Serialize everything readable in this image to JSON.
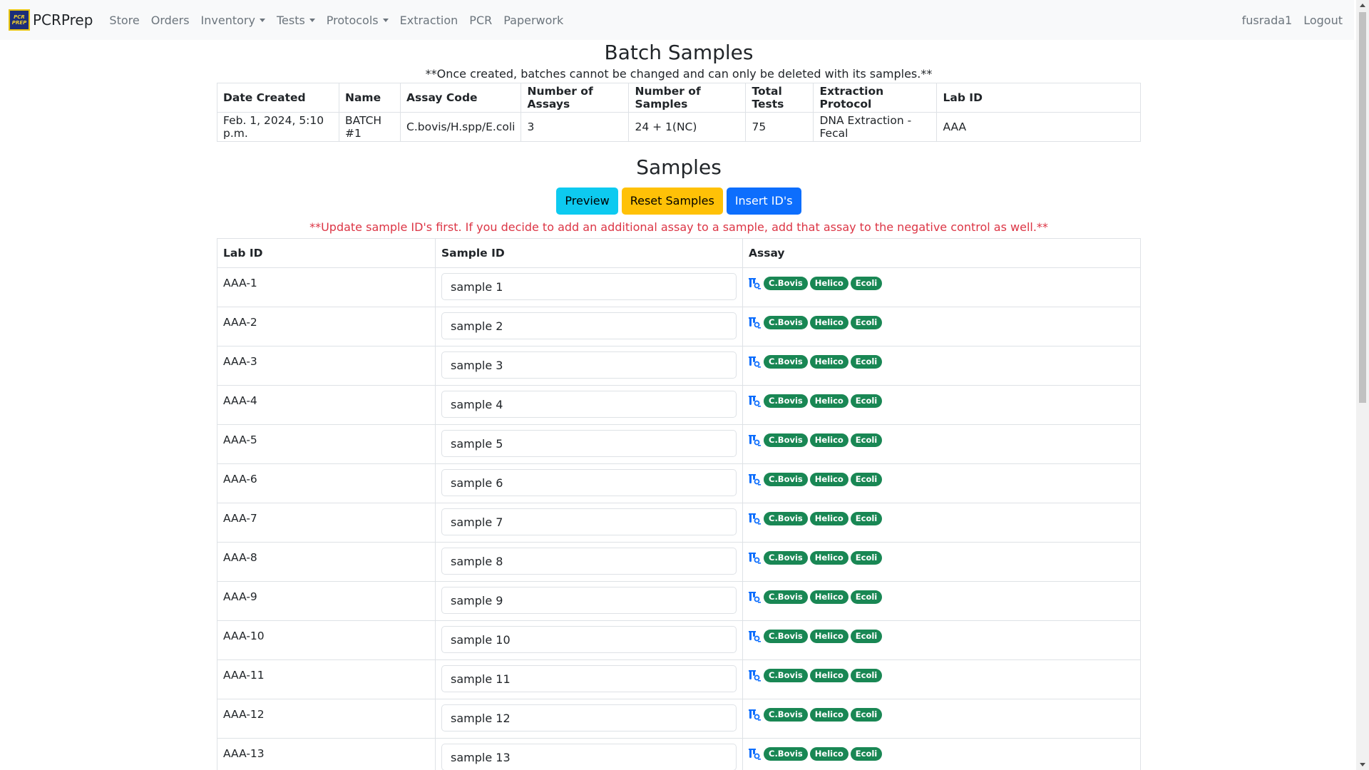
{
  "navbar": {
    "brand_logo_text": "PCR PREP",
    "brand": "PCRPrep",
    "items": [
      {
        "label": "Store",
        "dropdown": false
      },
      {
        "label": "Orders",
        "dropdown": false
      },
      {
        "label": "Inventory",
        "dropdown": true
      },
      {
        "label": "Tests",
        "dropdown": true
      },
      {
        "label": "Protocols",
        "dropdown": true
      },
      {
        "label": "Extraction",
        "dropdown": false
      },
      {
        "label": "PCR",
        "dropdown": false
      },
      {
        "label": "Paperwork",
        "dropdown": false
      }
    ],
    "user": "fusrada1",
    "logout": "Logout"
  },
  "batch": {
    "title": "Batch Samples",
    "note": "**Once created, batches cannot be changed and can only be deleted with its samples.**",
    "headers": [
      "Date Created",
      "Name",
      "Assay Code",
      "Number of Assays",
      "Number of Samples",
      "Total Tests",
      "Extraction Protocol",
      "Lab ID"
    ],
    "row": [
      "Feb. 1, 2024, 5:10 p.m.",
      "BATCH #1",
      "C.bovis/H.spp/E.coli",
      "3",
      "24 + 1(NC)",
      "75",
      "DNA Extraction - Fecal",
      "AAA"
    ]
  },
  "samples": {
    "title": "Samples",
    "buttons": {
      "preview": "Preview",
      "reset": "Reset Samples",
      "insert": "Insert ID's"
    },
    "warning": "**Update sample ID's first. If you decide to add an additional assay to a sample, add that assay to the negative control as well.**",
    "headers": [
      "Lab ID",
      "Sample ID",
      "Assay"
    ],
    "assay_badges": [
      "C.Bovis",
      "Helico",
      "Ecoli"
    ],
    "rows": [
      {
        "lab_id": "AAA-1",
        "sample_id": "sample 1"
      },
      {
        "lab_id": "AAA-2",
        "sample_id": "sample 2"
      },
      {
        "lab_id": "AAA-3",
        "sample_id": "sample 3"
      },
      {
        "lab_id": "AAA-4",
        "sample_id": "sample 4"
      },
      {
        "lab_id": "AAA-5",
        "sample_id": "sample 5"
      },
      {
        "lab_id": "AAA-6",
        "sample_id": "sample 6"
      },
      {
        "lab_id": "AAA-7",
        "sample_id": "sample 7"
      },
      {
        "lab_id": "AAA-8",
        "sample_id": "sample 8"
      },
      {
        "lab_id": "AAA-9",
        "sample_id": "sample 9"
      },
      {
        "lab_id": "AAA-10",
        "sample_id": "sample 10"
      },
      {
        "lab_id": "AAA-11",
        "sample_id": "sample 11"
      },
      {
        "lab_id": "AAA-12",
        "sample_id": "sample 12"
      },
      {
        "lab_id": "AAA-13",
        "sample_id": "sample 13"
      }
    ]
  },
  "colors": {
    "navbar_bg": "#f8f9fa",
    "badge_green": "#198754",
    "preview_btn": "#0dcaf0",
    "reset_btn": "#ffc107",
    "insert_btn": "#0d6efd",
    "warning_text": "#dc3545"
  }
}
